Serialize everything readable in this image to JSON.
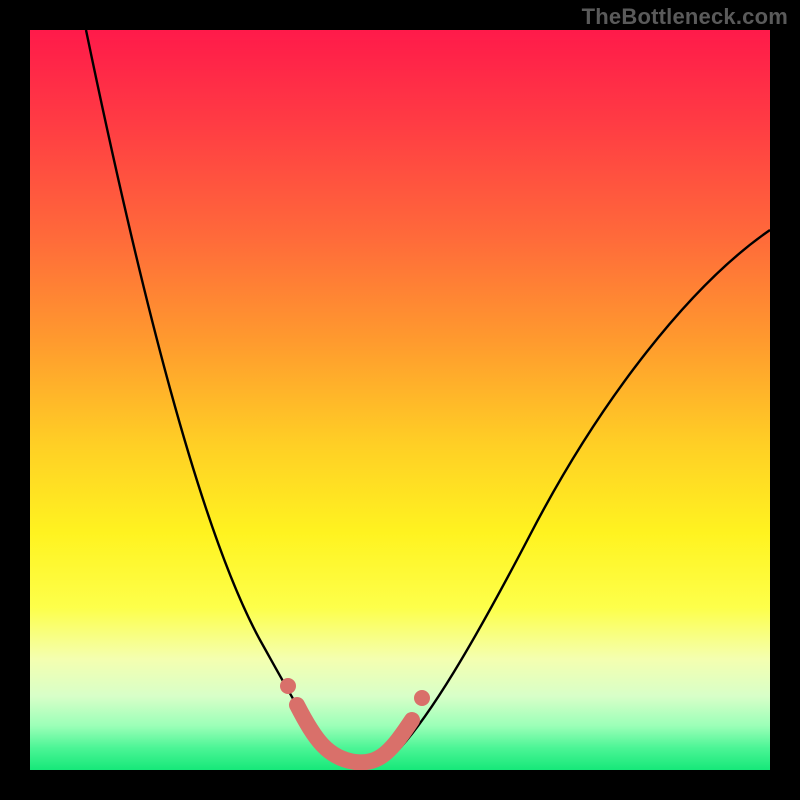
{
  "watermark": "TheBottleneck.com",
  "chart_data": {
    "type": "line",
    "title": "",
    "xlabel": "",
    "ylabel": "",
    "xlim": [
      0,
      100
    ],
    "ylim": [
      0,
      100
    ],
    "x": [
      0,
      2,
      5,
      8,
      10,
      15,
      20,
      25,
      28,
      30,
      32,
      35,
      38,
      40,
      42,
      45,
      48,
      50,
      55,
      60,
      65,
      70,
      80,
      90,
      100
    ],
    "values": [
      120,
      100,
      88,
      76,
      68,
      55,
      42,
      30,
      22,
      15,
      10,
      5,
      2,
      1,
      1,
      2,
      5,
      10,
      20,
      33,
      45,
      55,
      65,
      70,
      73
    ],
    "series": [
      {
        "name": "bottleneck-curve",
        "color": "#000000"
      }
    ],
    "highlight_range_x": [
      34,
      52
    ],
    "highlight_color": "#d9706a",
    "background_gradient_stops": [
      {
        "offset": 0.0,
        "color": "#ff1a4a"
      },
      {
        "offset": 0.12,
        "color": "#ff3a44"
      },
      {
        "offset": 0.28,
        "color": "#ff6a3a"
      },
      {
        "offset": 0.42,
        "color": "#ff9a2e"
      },
      {
        "offset": 0.56,
        "color": "#ffcf25"
      },
      {
        "offset": 0.68,
        "color": "#fff320"
      },
      {
        "offset": 0.78,
        "color": "#fdff4a"
      },
      {
        "offset": 0.85,
        "color": "#f4ffb0"
      },
      {
        "offset": 0.9,
        "color": "#d8ffc8"
      },
      {
        "offset": 0.94,
        "color": "#9cffb8"
      },
      {
        "offset": 0.97,
        "color": "#4cf596"
      },
      {
        "offset": 1.0,
        "color": "#16e879"
      }
    ]
  }
}
